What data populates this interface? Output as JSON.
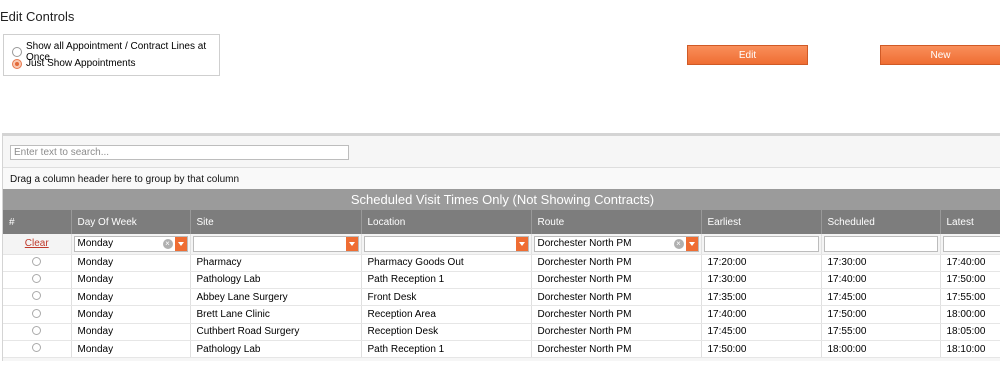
{
  "page": {
    "title": "Edit Controls"
  },
  "mode": {
    "options": [
      {
        "label": "Show all Appointment / Contract Lines at Once",
        "checked": false
      },
      {
        "label": "Just Show Appointments",
        "checked": true
      }
    ]
  },
  "buttons": {
    "edit": "Edit",
    "new": "New"
  },
  "grid": {
    "search_placeholder": "Enter text to search...",
    "group_hint": "Drag a column header here to group by that column",
    "caption": "Scheduled Visit Times Only (Not Showing Contracts)",
    "columns": [
      "#",
      "Day Of Week",
      "Site",
      "Location",
      "Route",
      "Earliest",
      "Scheduled",
      "Latest"
    ],
    "filters": {
      "clear_label": "Clear",
      "day": "Monday",
      "site": "",
      "location": "",
      "route": "Dorchester North PM",
      "earliest": "",
      "scheduled": "",
      "latest": ""
    },
    "rows": [
      {
        "day": "Monday",
        "site": "Pharmacy",
        "location": "Pharmacy Goods Out",
        "route": "Dorchester North PM",
        "earliest": "17:20:00",
        "scheduled": "17:30:00",
        "latest": "17:40:00"
      },
      {
        "day": "Monday",
        "site": "Pathology Lab",
        "location": "Path Reception 1",
        "route": "Dorchester North PM",
        "earliest": "17:30:00",
        "scheduled": "17:40:00",
        "latest": "17:50:00"
      },
      {
        "day": "Monday",
        "site": "Abbey Lane Surgery",
        "location": "Front Desk",
        "route": "Dorchester North PM",
        "earliest": "17:35:00",
        "scheduled": "17:45:00",
        "latest": "17:55:00"
      },
      {
        "day": "Monday",
        "site": "Brett Lane Clinic",
        "location": "Reception Area",
        "route": "Dorchester North PM",
        "earliest": "17:40:00",
        "scheduled": "17:50:00",
        "latest": "18:00:00"
      },
      {
        "day": "Monday",
        "site": "Cuthbert Road Surgery",
        "location": "Reception Desk",
        "route": "Dorchester North PM",
        "earliest": "17:45:00",
        "scheduled": "17:55:00",
        "latest": "18:05:00"
      },
      {
        "day": "Monday",
        "site": "Pathology Lab",
        "location": "Path Reception 1",
        "route": "Dorchester North PM",
        "earliest": "17:50:00",
        "scheduled": "18:00:00",
        "latest": "18:10:00"
      }
    ]
  }
}
